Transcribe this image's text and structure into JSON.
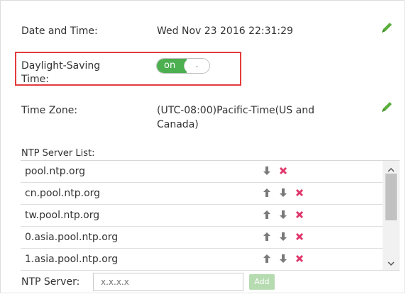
{
  "date_time": {
    "label": "Date and Time:",
    "value": "Wed Nov 23 2016 22:31:29"
  },
  "dst": {
    "label_line1": "Daylight-Saving",
    "label_line2": "Time:",
    "toggle_text": "on",
    "knob_text": ".",
    "enabled": true
  },
  "time_zone": {
    "label": "Time Zone:",
    "value_line1": "(UTC-08:00)Pacific-Time(US and",
    "value_line2": "Canada)"
  },
  "ntp_list": {
    "label": "NTP Server List:",
    "rows": [
      {
        "host": "pool.ntp.org",
        "up": false,
        "down": true,
        "delete": true
      },
      {
        "host": "cn.pool.ntp.org",
        "up": true,
        "down": true,
        "delete": true
      },
      {
        "host": "tw.pool.ntp.org",
        "up": true,
        "down": true,
        "delete": true
      },
      {
        "host": "0.asia.pool.ntp.org",
        "up": true,
        "down": true,
        "delete": true
      },
      {
        "host": "1.asia.pool.ntp.org",
        "up": true,
        "down": true,
        "delete": true
      }
    ]
  },
  "ntp_input": {
    "label": "NTP Server:",
    "placeholder": "x.x.x.x",
    "add_label": "Add"
  },
  "colors": {
    "accent_green": "#4caf50",
    "delete_red": "#e0356a",
    "arrow_gray": "#7a7a7a",
    "highlight_red": "#e33b3b"
  },
  "icons": {
    "edit": "pencil-icon",
    "up": "arrow-up-icon",
    "down": "arrow-down-icon",
    "delete": "delete-x-icon"
  }
}
